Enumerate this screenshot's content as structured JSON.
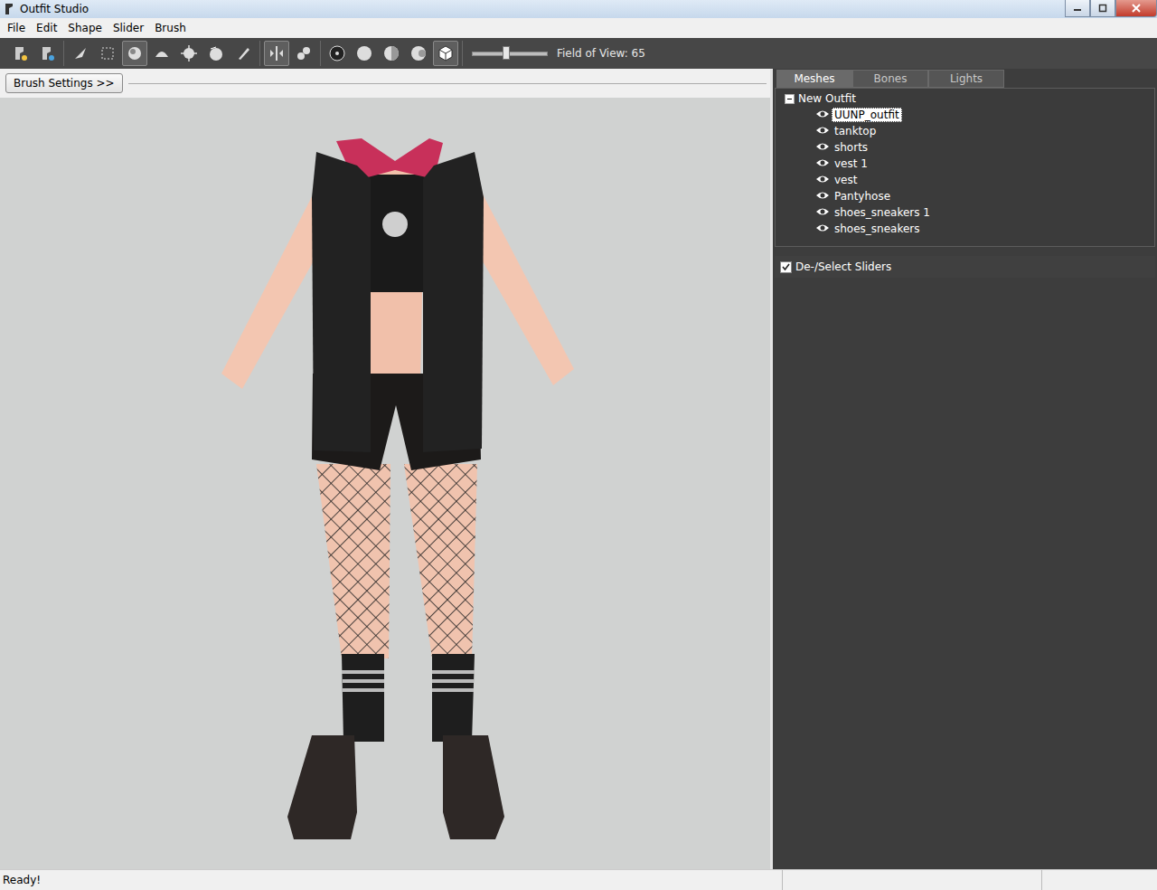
{
  "window": {
    "title": "Outfit Studio"
  },
  "menu": [
    "File",
    "Edit",
    "Shape",
    "Slider",
    "Brush"
  ],
  "toolbar": {
    "groups": [
      {
        "tools": [
          {
            "selected": false
          },
          {
            "selected": false
          }
        ]
      },
      {
        "tools": [
          {
            "selected": false
          },
          {
            "selected": false
          },
          {
            "selected": true
          },
          {
            "selected": false
          },
          {
            "selected": false
          },
          {
            "selected": false
          },
          {
            "selected": false
          }
        ]
      },
      {
        "tools": [
          {
            "selected": true
          },
          {
            "selected": false
          }
        ]
      },
      {
        "tools": [
          {
            "selected": false
          },
          {
            "selected": false
          },
          {
            "selected": false
          },
          {
            "selected": false
          },
          {
            "selected": true
          }
        ]
      }
    ],
    "fov": {
      "level": 0.45,
      "label": "Field of View: 65"
    }
  },
  "brush_settings": "Brush Settings >>",
  "tabs": [
    {
      "label": "Meshes",
      "selected": true
    },
    {
      "label": "Bones",
      "selected": false
    },
    {
      "label": "Lights",
      "selected": false
    }
  ],
  "tree": {
    "root": "New Outfit",
    "expanded": true,
    "items": [
      {
        "label": "UUNP_outfit",
        "visible": true,
        "selected": true
      },
      {
        "label": "tanktop",
        "visible": true,
        "selected": false
      },
      {
        "label": "shorts",
        "visible": true,
        "selected": false
      },
      {
        "label": "vest 1",
        "visible": true,
        "selected": false
      },
      {
        "label": "vest",
        "visible": true,
        "selected": false
      },
      {
        "label": "Pantyhose",
        "visible": true,
        "selected": false
      },
      {
        "label": "shoes_sneakers 1",
        "visible": true,
        "selected": false
      },
      {
        "label": "shoes_sneakers",
        "visible": true,
        "selected": false
      }
    ]
  },
  "sliders": {
    "label": "De-/Select Sliders",
    "checked": true
  },
  "status_bar": "Ready!"
}
